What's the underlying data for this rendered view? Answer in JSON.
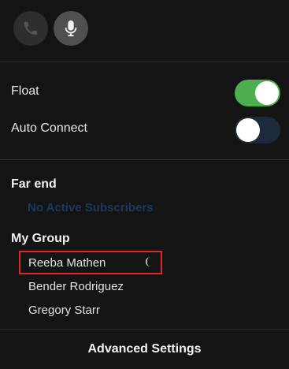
{
  "call_controls": {
    "phone_icon": "phone-icon",
    "mic_icon": "microphone-icon"
  },
  "settings": {
    "float_label": "Float",
    "float_enabled": true,
    "auto_connect_label": "Auto Connect",
    "auto_connect_enabled": false
  },
  "far_end": {
    "title": "Far end",
    "empty_message": "No Active Subscribers"
  },
  "my_group": {
    "title": "My Group",
    "members": [
      {
        "name": "Reeba Mathen",
        "status_icon": "crescent-icon"
      },
      {
        "name": "Bender Rodriguez"
      },
      {
        "name": "Gregory Starr"
      }
    ]
  },
  "footer": {
    "advanced_settings_label": "Advanced Settings"
  },
  "colors": {
    "background": "#141414",
    "toggle_on": "#4cae4f",
    "toggle_off": "#1d2a3c",
    "highlight": "#e0252b",
    "muted_text": "#1b3a5c"
  }
}
